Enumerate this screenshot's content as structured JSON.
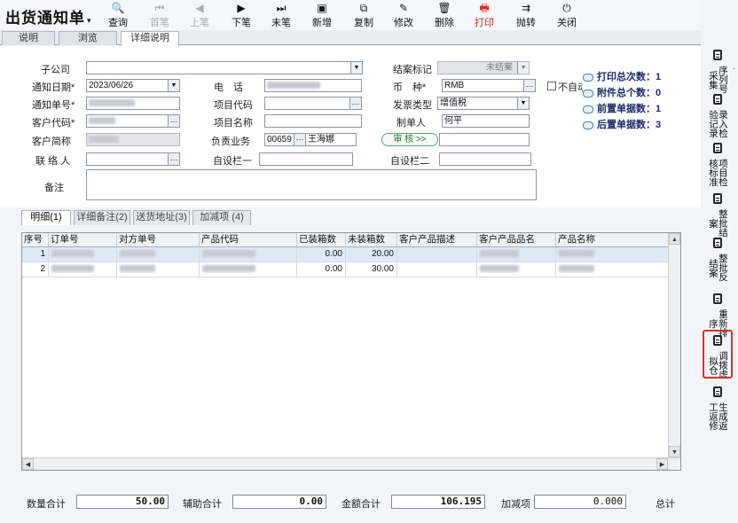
{
  "app": {
    "title": "出货通知单",
    "title_arrow": "▾"
  },
  "toolbar": [
    {
      "label": "查询",
      "icon": "🔍",
      "state": "enabled"
    },
    {
      "label": "首笔",
      "icon": "⏮",
      "state": "disabled"
    },
    {
      "label": "上笔",
      "icon": "◀",
      "state": "disabled"
    },
    {
      "label": "下笔",
      "icon": "▶",
      "state": "enabled"
    },
    {
      "label": "末笔",
      "icon": "⏭",
      "state": "enabled"
    },
    {
      "label": "新增",
      "icon": "▣",
      "state": "enabled"
    },
    {
      "label": "复制",
      "icon": "⧉",
      "state": "enabled"
    },
    {
      "label": "修改",
      "icon": "✎",
      "state": "enabled"
    },
    {
      "label": "删除",
      "icon": "🗑",
      "state": "enabled"
    },
    {
      "label": "打印",
      "icon": "🖶",
      "state": "highlight"
    },
    {
      "label": "抛转",
      "icon": "⇉",
      "state": "enabled"
    },
    {
      "label": "关闭",
      "icon": "⏻",
      "state": "enabled"
    }
  ],
  "tabs": [
    {
      "label": "说明",
      "active": false
    },
    {
      "label": "浏览",
      "active": false
    },
    {
      "label": "详细说明",
      "active": true
    }
  ],
  "form": {
    "subsidiary_label": "子公司",
    "subsidiary_value": "",
    "close_flag_label": "结案标记",
    "close_flag_value": "未结案",
    "notice_date_label": "通知日期*",
    "notice_date_value": "2023/06/26",
    "phone_label": "电　话",
    "currency_label": "币　种*",
    "currency_value": "RMB",
    "not_auto_label": "不自动",
    "notice_no_label": "通知单号*",
    "item_code_label": "项目代码",
    "item_code_value": "",
    "invoice_type_label": "发票类型",
    "invoice_type_value": "增值税",
    "customer_code_label": "客户代码*",
    "item_name_label": "项目名称",
    "item_name_value": "",
    "maker_label": "制单人",
    "maker_value": "何平",
    "customer_short_label": "客户简称",
    "salesperson_label": "负责业务",
    "salesperson_code": "00659",
    "salesperson_name": "王海娜",
    "audit_button": "审 核 >>",
    "contact_label": "联 络 人",
    "custom1_label": "自设栏一",
    "custom2_label": "自设栏二",
    "remark_label": "备注"
  },
  "stats": [
    {
      "label": "打印总次数",
      "value": "1"
    },
    {
      "label": "附件总个数",
      "value": "0"
    },
    {
      "label": "前置单据数",
      "value": "1"
    },
    {
      "label": "后置单据数",
      "value": "3"
    }
  ],
  "detail_tabs": [
    {
      "label": "明细(1)",
      "active": true
    },
    {
      "label": "详细备注(2)",
      "active": false
    },
    {
      "label": "送货地址(3)",
      "active": false
    },
    {
      "label": "加减项 (4)",
      "active": false
    }
  ],
  "grid": {
    "columns": [
      "序号",
      "订单号",
      "对方单号",
      "产品代码",
      "已装箱数",
      "未装箱数",
      "客户产品描述",
      "客户产品品名",
      "产品名称"
    ],
    "rows": [
      {
        "seq": "1",
        "packed": "0.00",
        "unpacked": "20.00"
      },
      {
        "seq": "2",
        "packed": "0.00",
        "unpacked": "30.00"
      }
    ]
  },
  "totals": {
    "qty_label": "数量合计",
    "qty_value": "50.00",
    "aux_label": "辅助合计",
    "aux_value": "0.00",
    "amount_label": "金额合计",
    "amount_value": "106.195",
    "addsub_label": "加减项",
    "addsub_value": "0.000",
    "grand_label": "总计"
  },
  "sidebar": [
    {
      "label": "序列号采集"
    },
    {
      "label": "录入检验记录"
    },
    {
      "label": "项目检核标准"
    },
    {
      "label": "整批结案"
    },
    {
      "label": "整批反结案"
    },
    {
      "label": "重新排序"
    },
    {
      "label": "调拨虚拟仓",
      "highlighted": true
    },
    {
      "label": "生成返工返修"
    }
  ],
  "colors": {
    "accent_red": "#d42a2a",
    "highlight_border": "#d9302b",
    "row_selected": "#dfe8f5",
    "stat_text": "#1b2a6b"
  }
}
